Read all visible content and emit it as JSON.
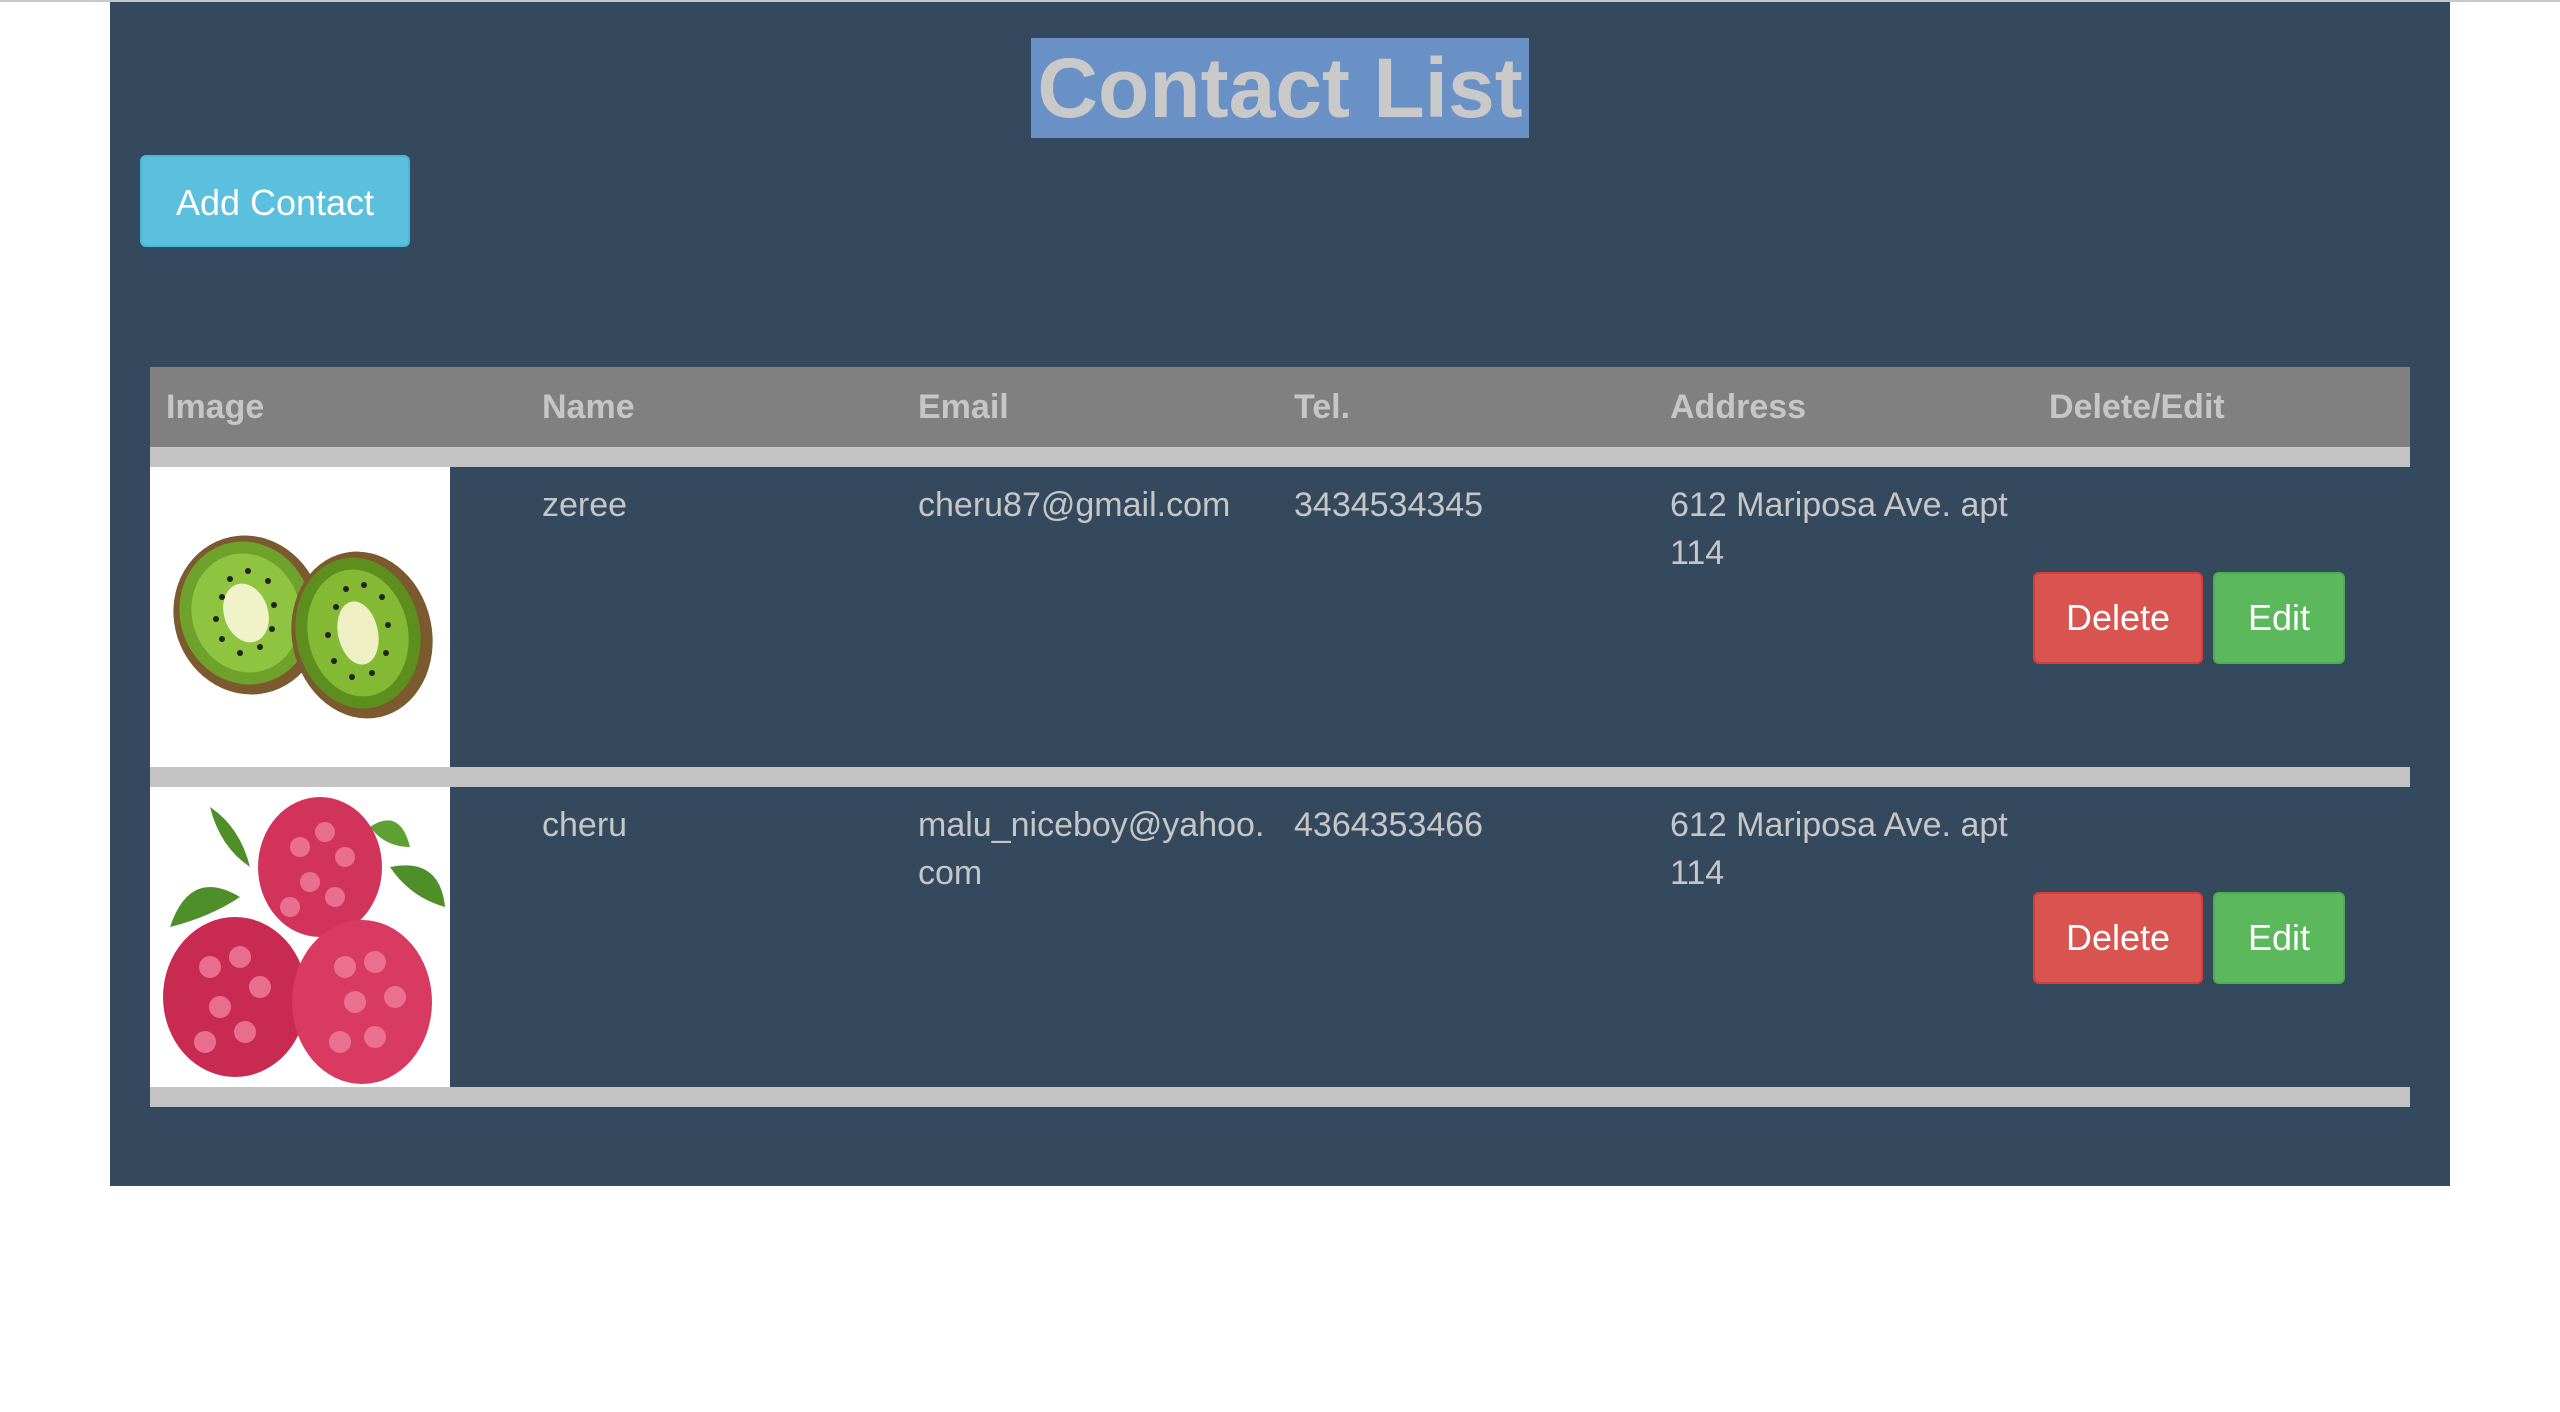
{
  "page": {
    "title": "Contact List",
    "add_button_label": "Add Contact"
  },
  "table": {
    "headers": [
      "Image",
      "Name",
      "Email",
      "Tel.",
      "Address",
      "Delete/Edit"
    ],
    "rows": [
      {
        "image": "kiwi-fruit",
        "name": "zeree",
        "email": "cheru87@gmail.com",
        "tel": "3434534345",
        "address": "612 Mariposa Ave. apt 114",
        "delete_label": "Delete",
        "edit_label": "Edit"
      },
      {
        "image": "raspberry-fruit",
        "name": "cheru",
        "email": "malu_niceboy@yahoo.com",
        "tel": "4364353466",
        "address": "612 Mariposa Ave. apt 114",
        "delete_label": "Delete",
        "edit_label": "Edit"
      }
    ]
  },
  "colors": {
    "panel_bg": "#34495e",
    "title_highlight": "#6a91c5",
    "add_button": "#5bc0de",
    "delete_button": "#d9534f",
    "edit_button": "#5cb85c",
    "header_bg": "#808080"
  }
}
